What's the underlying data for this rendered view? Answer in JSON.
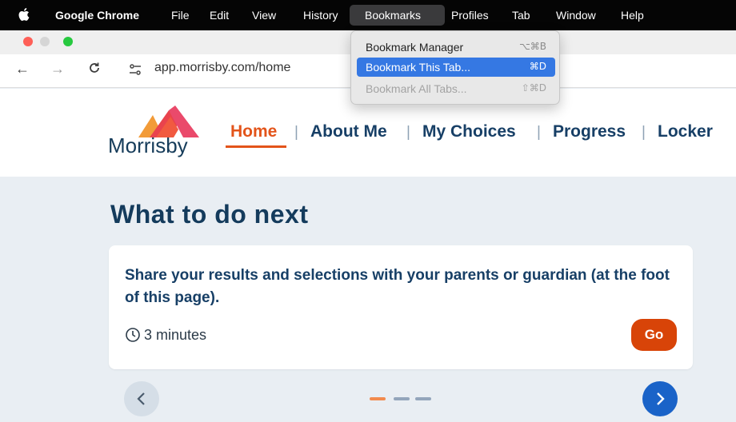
{
  "menubar": {
    "apple_icon": "apple-logo-icon",
    "app_name": "Google Chrome",
    "items": [
      "File",
      "Edit",
      "View",
      "History",
      "Bookmarks",
      "Profiles",
      "Tab",
      "Window",
      "Help"
    ],
    "active_item": "Bookmarks"
  },
  "dropdown": {
    "items": [
      {
        "label": "Bookmark Manager",
        "shortcut": "⌥⌘B",
        "state": "normal"
      },
      {
        "label": "Bookmark This Tab...",
        "shortcut": "⌘D",
        "state": "highlighted"
      },
      {
        "label": "Bookmark All Tabs...",
        "shortcut": "⇧⌘D",
        "state": "disabled"
      }
    ]
  },
  "browser": {
    "back_icon": "←",
    "forward_icon": "→",
    "reload_icon": "C",
    "site_info_icon": "⚯",
    "url": "app.morrisby.com/home"
  },
  "site": {
    "logo_text": "Morrisby",
    "nav": [
      {
        "label": "Home",
        "active": true
      },
      {
        "label": "About Me",
        "active": false
      },
      {
        "label": "My Choices",
        "active": false
      },
      {
        "label": "Progress",
        "active": false
      },
      {
        "label": "Locker",
        "active": false
      }
    ],
    "separator": "|",
    "accent_color": "#e3541a",
    "primary_color": "#173f66"
  },
  "main": {
    "heading": "What to do next",
    "card": {
      "text": "Share your results and selections with your parents or guardian (at the foot of this page).",
      "duration": "3 minutes",
      "go_label": "Go"
    },
    "carousel": {
      "prev_icon": "‹",
      "next_icon": "›",
      "dots": 3,
      "active_dot": 1
    }
  }
}
